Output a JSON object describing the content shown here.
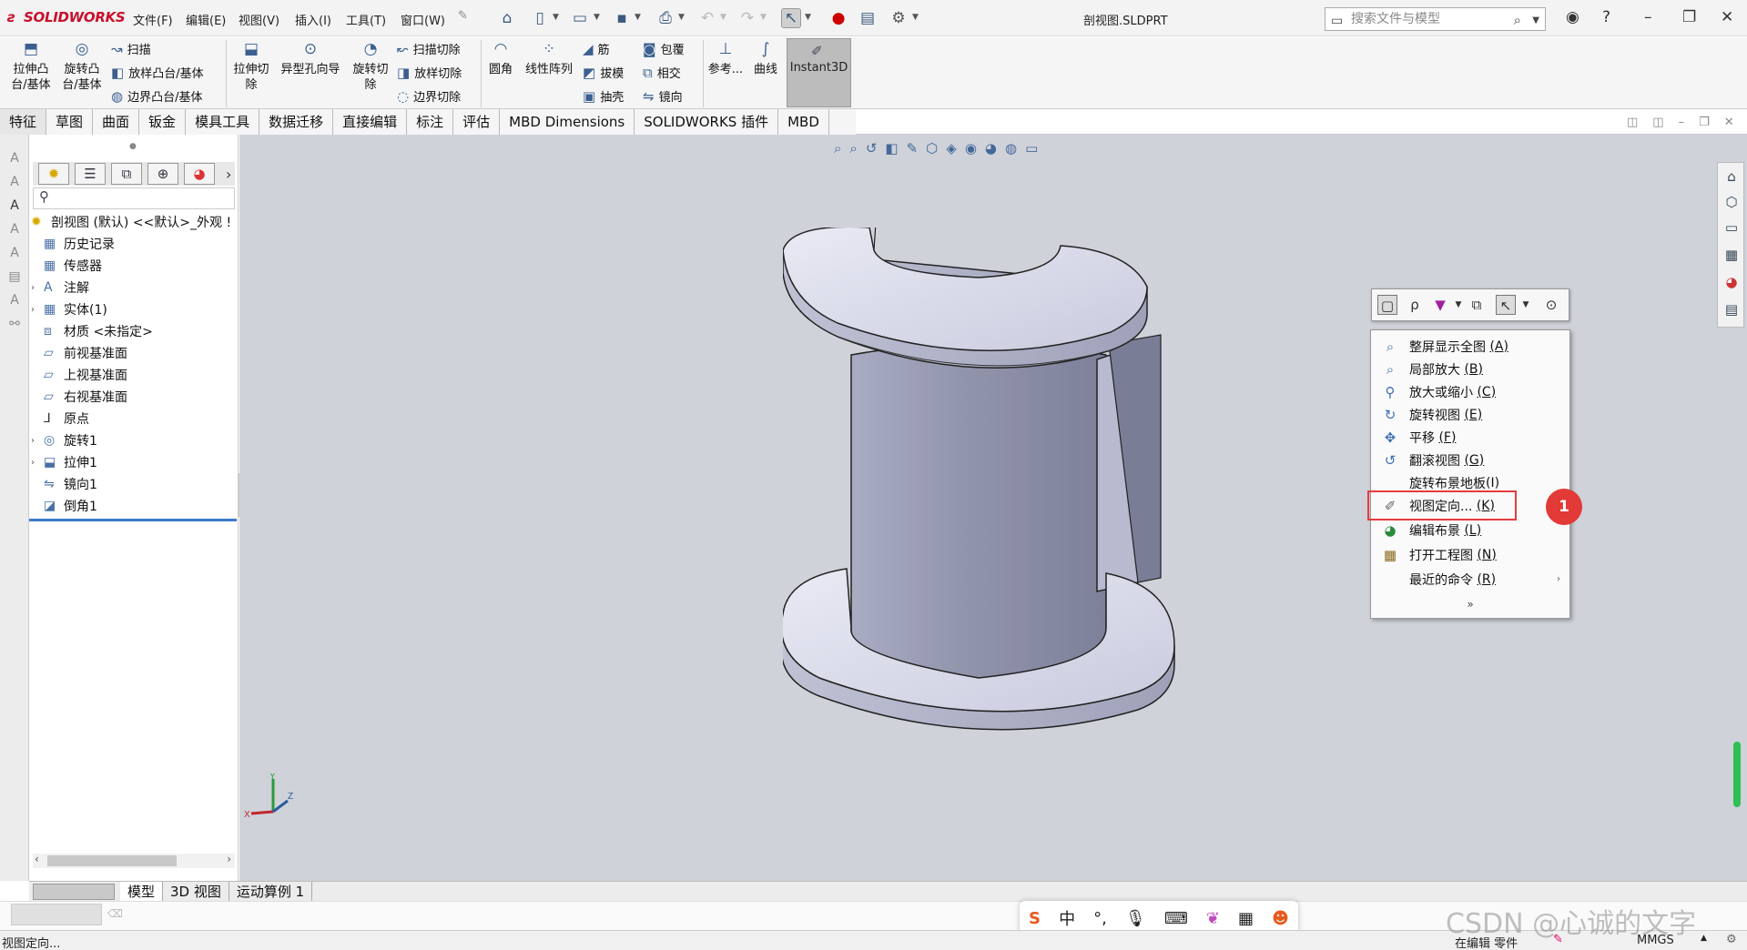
{
  "app": {
    "brand": "SOLIDWORKS",
    "document_title": "剖视图.SLDPRT"
  },
  "menubar": {
    "items": [
      "文件(F)",
      "编辑(E)",
      "视图(V)",
      "插入(I)",
      "工具(T)",
      "窗口(W)"
    ]
  },
  "search": {
    "placeholder": "搜索文件与模型"
  },
  "ribbon": {
    "extrude_boss": "拉伸凸台/基体",
    "revolve_boss": "旋转凸台/基体",
    "sweep": "扫描",
    "loft_boss": "放样凸台/基体",
    "boundary_boss": "边界凸台/基体",
    "extrude_cut": "拉伸切除",
    "hole_wizard": "异型孔向导",
    "revolve_cut": "旋转切除",
    "sweep_cut": "扫描切除",
    "loft_cut": "放样切除",
    "boundary_cut": "边界切除",
    "fillet": "圆角",
    "linear_pattern": "线性阵列",
    "rib": "筋",
    "draft": "拔模",
    "shell": "抽壳",
    "wrap": "包覆",
    "intersect": "相交",
    "mirror": "镜向",
    "reference": "参考...",
    "curves": "曲线",
    "instant3d": "Instant3D"
  },
  "tabs": [
    "特征",
    "草图",
    "曲面",
    "钣金",
    "模具工具",
    "数据迁移",
    "直接编辑",
    "标注",
    "评估",
    "MBD Dimensions",
    "SOLIDWORKS 插件",
    "MBD"
  ],
  "tree": {
    "root": "剖视图 (默认) <<默认>_外观 !",
    "nodes": [
      {
        "label": "历史记录",
        "icon": "history-icon"
      },
      {
        "label": "传感器",
        "icon": "sensor-icon"
      },
      {
        "label": "注解",
        "icon": "annotation-icon",
        "expandable": true
      },
      {
        "label": "实体(1)",
        "icon": "solid-body-icon",
        "expandable": true
      },
      {
        "label": "材质 <未指定>",
        "icon": "material-icon"
      },
      {
        "label": "前视基准面",
        "icon": "plane-icon"
      },
      {
        "label": "上视基准面",
        "icon": "plane-icon"
      },
      {
        "label": "右视基准面",
        "icon": "plane-icon"
      },
      {
        "label": "原点",
        "icon": "origin-icon"
      },
      {
        "label": "旋转1",
        "icon": "revolve-icon",
        "expandable": true
      },
      {
        "label": "拉伸1",
        "icon": "extrude-icon",
        "expandable": true
      },
      {
        "label": "镜向1",
        "icon": "mirror-icon"
      },
      {
        "label": "倒角1",
        "icon": "chamfer-icon"
      }
    ]
  },
  "context_menu": {
    "items": [
      {
        "label": "整屏显示全图",
        "key": "(A)",
        "icon": "zoom-fit-icon"
      },
      {
        "label": "局部放大",
        "key": "(B)",
        "icon": "zoom-area-icon"
      },
      {
        "label": "放大或缩小",
        "key": "(C)",
        "icon": "zoom-in-out-icon"
      },
      {
        "label": "旋转视图",
        "key": "(E)",
        "icon": "rotate-view-icon"
      },
      {
        "label": "平移",
        "key": "(F)",
        "icon": "pan-icon"
      },
      {
        "label": "翻滚视图",
        "key": "(G)",
        "icon": "roll-view-icon"
      },
      {
        "label": "旋转布景地板",
        "key": "(I)",
        "icon": ""
      },
      {
        "label": "视图定向...",
        "key": "(K)",
        "icon": "view-orientation-icon"
      },
      {
        "label": "编辑布景",
        "key": "(L)",
        "icon": "edit-scene-icon"
      },
      {
        "label": "打开工程图",
        "key": "(N)",
        "icon": "open-drawing-icon"
      },
      {
        "label": "最近的命令",
        "key": "(R)",
        "icon": ""
      }
    ],
    "highlighted_index": 7,
    "badge": "1"
  },
  "triad": {
    "x": "X",
    "y": "Y",
    "z": "Z"
  },
  "bottom_tabs": [
    "模型",
    "3D 视图",
    "运动算例 1"
  ],
  "status": {
    "left": "视图定向...",
    "editing": "在编辑 零件",
    "units": "MMGS"
  },
  "ime": {
    "mode": "中",
    "punct": "°,"
  },
  "watermark": "CSDN @心诚的文字",
  "colors": {
    "highlight_border": "#e63c3c",
    "badge": "#e23a36",
    "viewport_bg": "#cfd2d9",
    "part_fill": "#b0b3cc"
  }
}
